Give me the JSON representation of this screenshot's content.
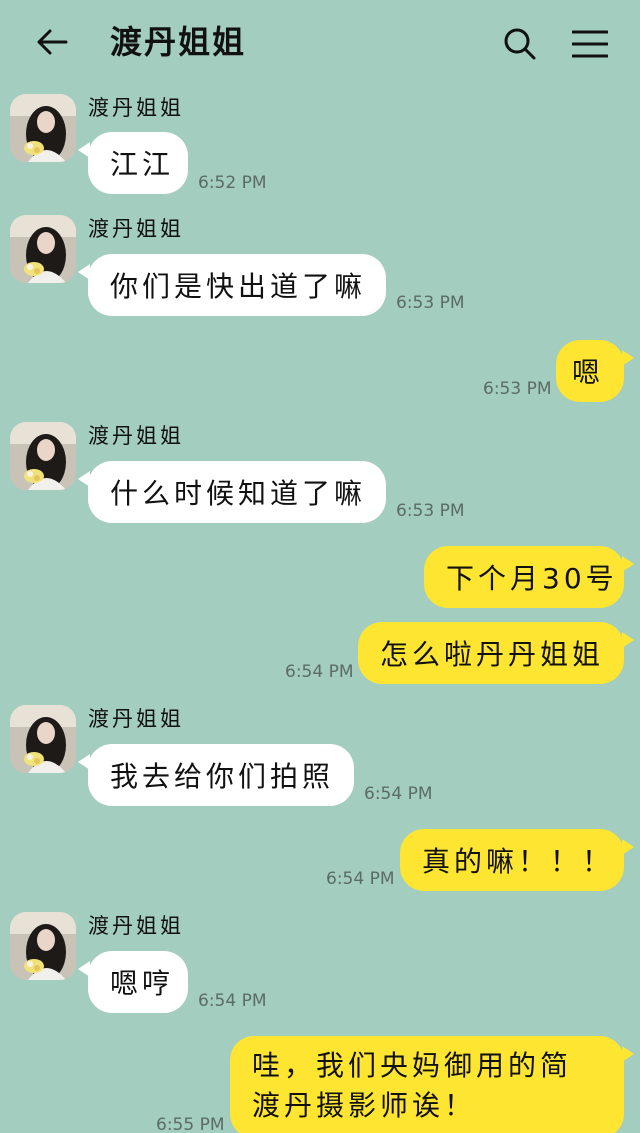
{
  "header": {
    "title": "渡丹姐姐"
  },
  "icons": {
    "back": "arrow-left-icon",
    "search": "search-icon",
    "menu": "hamburger-menu-icon"
  },
  "colors": {
    "background": "#a3cdbf",
    "incoming_bubble": "#ffffff",
    "outgoing_bubble": "#fde531",
    "timestamp": "#5b6b66"
  },
  "messages": [
    {
      "sender": "渡丹姐姐",
      "direction": "in",
      "text": "江江",
      "time": "6:52 PM"
    },
    {
      "sender": "渡丹姐姐",
      "direction": "in",
      "text": "你们是快出道了嘛",
      "time": "6:53 PM"
    },
    {
      "direction": "out",
      "text": "嗯",
      "time": "6:53 PM"
    },
    {
      "sender": "渡丹姐姐",
      "direction": "in",
      "text": "什么时候知道了嘛",
      "time": "6:53 PM"
    },
    {
      "direction": "out",
      "text": "下个月30号",
      "time": ""
    },
    {
      "direction": "out",
      "text": "怎么啦丹丹姐姐",
      "time": "6:54 PM"
    },
    {
      "sender": "渡丹姐姐",
      "direction": "in",
      "text": "我去给你们拍照",
      "time": "6:54 PM"
    },
    {
      "direction": "out",
      "text": "真的嘛！！！",
      "time": "6:54 PM"
    },
    {
      "sender": "渡丹姐姐",
      "direction": "in",
      "text": "嗯哼",
      "time": "6:54 PM"
    },
    {
      "direction": "out",
      "text": "哇，我们央妈御用的简渡丹摄影师诶！",
      "time": "6:55 PM"
    }
  ]
}
